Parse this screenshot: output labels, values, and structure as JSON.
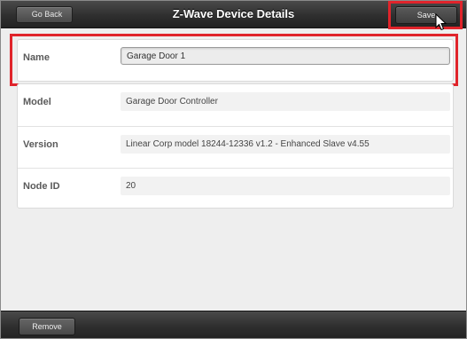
{
  "header": {
    "back_label": "Go Back",
    "title": "Z-Wave Device Details",
    "save_label": "Save"
  },
  "fields": {
    "name": {
      "label": "Name",
      "value": "Garage Door 1"
    },
    "model": {
      "label": "Model",
      "value": "Garage Door Controller"
    },
    "version": {
      "label": "Version",
      "value": "Linear Corp model 18244-12336 v1.2 - Enhanced Slave v4.55"
    },
    "node_id": {
      "label": "Node ID",
      "value": "20"
    }
  },
  "footer": {
    "remove_label": "Remove"
  },
  "colors": {
    "highlight": "#e0242b",
    "bar": "#2f2f2f"
  }
}
